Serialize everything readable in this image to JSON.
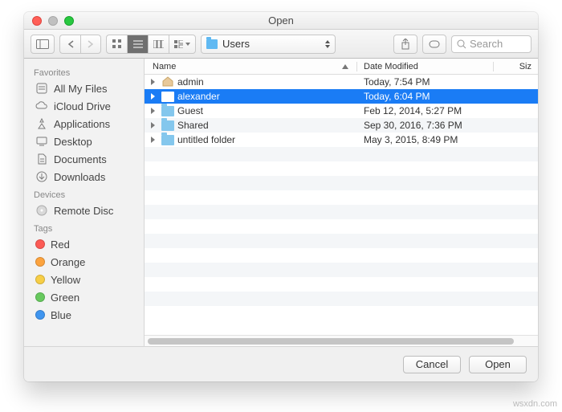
{
  "window_title": "Open",
  "path_dropdown": {
    "label": "Users"
  },
  "search": {
    "placeholder": "Search"
  },
  "columns": {
    "name": "Name",
    "date": "Date Modified",
    "size": "Siz"
  },
  "sidebar": {
    "groups": [
      {
        "title": "Favorites",
        "items": [
          {
            "label": "All My Files",
            "icon": "allmyfiles-icon"
          },
          {
            "label": "iCloud Drive",
            "icon": "icloud-icon"
          },
          {
            "label": "Applications",
            "icon": "applications-icon"
          },
          {
            "label": "Desktop",
            "icon": "desktop-icon"
          },
          {
            "label": "Documents",
            "icon": "documents-icon"
          },
          {
            "label": "Downloads",
            "icon": "downloads-icon"
          }
        ]
      },
      {
        "title": "Devices",
        "items": [
          {
            "label": "Remote Disc",
            "icon": "remotedisc-icon"
          }
        ]
      },
      {
        "title": "Tags",
        "items": [
          {
            "label": "Red",
            "icon": "tag-icon",
            "color": "#fc5b55"
          },
          {
            "label": "Orange",
            "icon": "tag-icon",
            "color": "#fca33e"
          },
          {
            "label": "Yellow",
            "icon": "tag-icon",
            "color": "#f7ce46"
          },
          {
            "label": "Green",
            "icon": "tag-icon",
            "color": "#67c95e"
          },
          {
            "label": "Blue",
            "icon": "tag-icon",
            "color": "#3f95ef"
          }
        ]
      }
    ]
  },
  "files": [
    {
      "name": "admin",
      "date": "Today, 7:54 PM",
      "icon": "home",
      "selected": false
    },
    {
      "name": "alexander",
      "date": "Today, 6:04 PM",
      "icon": "folder-white",
      "selected": true
    },
    {
      "name": "Guest",
      "date": "Feb 12, 2014, 5:27 PM",
      "icon": "folder",
      "selected": false
    },
    {
      "name": "Shared",
      "date": "Sep 30, 2016, 7:36 PM",
      "icon": "folder",
      "selected": false
    },
    {
      "name": "untitled folder",
      "date": "May 3, 2015, 8:49 PM",
      "icon": "folder",
      "selected": false
    }
  ],
  "footer": {
    "cancel": "Cancel",
    "open": "Open"
  },
  "watermark": "wsxdn.com"
}
